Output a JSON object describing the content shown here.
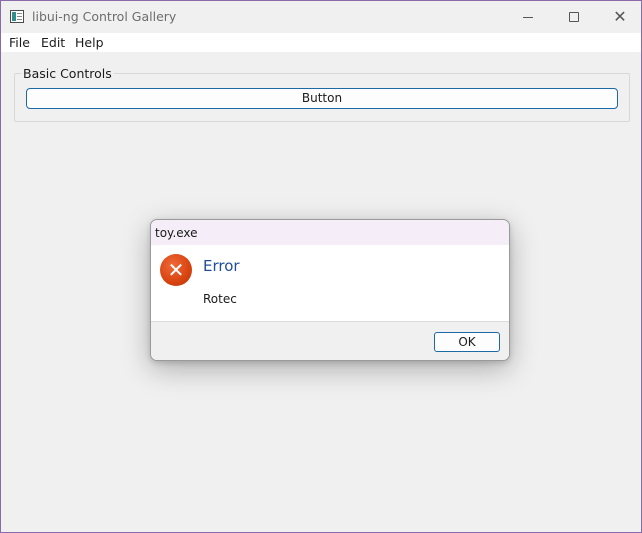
{
  "window": {
    "title": "libui-ng Control Gallery"
  },
  "menubar": {
    "items": [
      {
        "label": "File"
      },
      {
        "label": "Edit"
      },
      {
        "label": "Help"
      }
    ]
  },
  "group": {
    "label": "Basic Controls",
    "button_label": "Button"
  },
  "dialog": {
    "title": "toy.exe",
    "icon": "error-icon",
    "heading": "Error",
    "message": "Rotec",
    "ok_label": "OK"
  },
  "colors": {
    "accent": "#1b6aa8",
    "heading": "#1f4e9b",
    "error": "#d8430f"
  }
}
